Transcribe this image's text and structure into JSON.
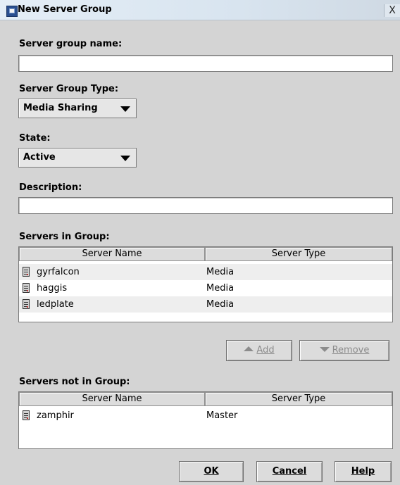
{
  "window": {
    "title": "New Server Group",
    "close_label": "X",
    "app_icon": "server-group-icon"
  },
  "form": {
    "group_name_label": "Server group name:",
    "group_name_value": "",
    "group_type_label": "Server Group Type:",
    "group_type_value": "Media Sharing",
    "state_label": "State:",
    "state_value": "Active",
    "description_label": "Description:",
    "description_value": ""
  },
  "servers_in_group": {
    "label": "Servers in Group:",
    "columns": [
      "Server Name",
      "Server Type"
    ],
    "rows": [
      {
        "name": "gyrfalcon",
        "type": "Media"
      },
      {
        "name": "haggis",
        "type": "Media"
      },
      {
        "name": "ledplate",
        "type": "Media"
      }
    ]
  },
  "actions": {
    "add_label": "Add",
    "remove_label": "Remove"
  },
  "servers_not_in_group": {
    "label": "Servers not in Group:",
    "columns": [
      "Server Name",
      "Server Type"
    ],
    "rows": [
      {
        "name": "zamphir",
        "type": "Master"
      }
    ]
  },
  "footer": {
    "ok_label": "OK",
    "cancel_label": "Cancel",
    "help_label": "Help"
  }
}
